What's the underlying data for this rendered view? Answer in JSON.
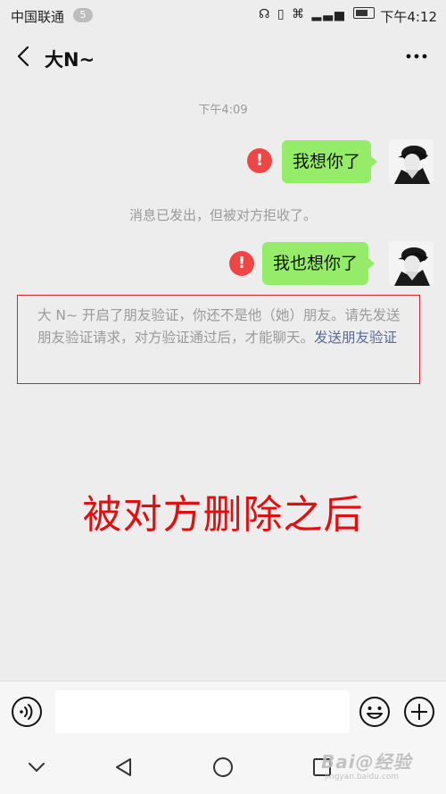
{
  "status_bar": {
    "carrier": "中国联通",
    "sim_badge": "5",
    "time": "下午4:12"
  },
  "header": {
    "title": "大N~",
    "back_icon": "chevron-left-icon",
    "more_icon": "more-dots-icon"
  },
  "chat": {
    "time_label": "下午4:09",
    "messages": [
      {
        "text": "我想你了",
        "status": "error"
      },
      {
        "text": "我也想你了",
        "status": "error"
      }
    ],
    "rejected_note": "消息已发出，但被对方拒收了。",
    "verify_notice": "大 N~ 开启了朋友验证，你还不是他（她）朋友。请先发送朋友验证请求，对方验证通过后，才能聊天。",
    "verify_link": "发送朋友验证"
  },
  "annotation": {
    "caption": "被对方删除之后"
  },
  "input_bar": {
    "placeholder": ""
  },
  "watermark": {
    "logo": "Bai@经验",
    "sub": "jingyan.baidu.com"
  },
  "colors": {
    "bubble": "#95ec69",
    "error": "#f04545",
    "link": "#576b95",
    "caption": "#e01010",
    "highlight_box": "#d9232a"
  }
}
